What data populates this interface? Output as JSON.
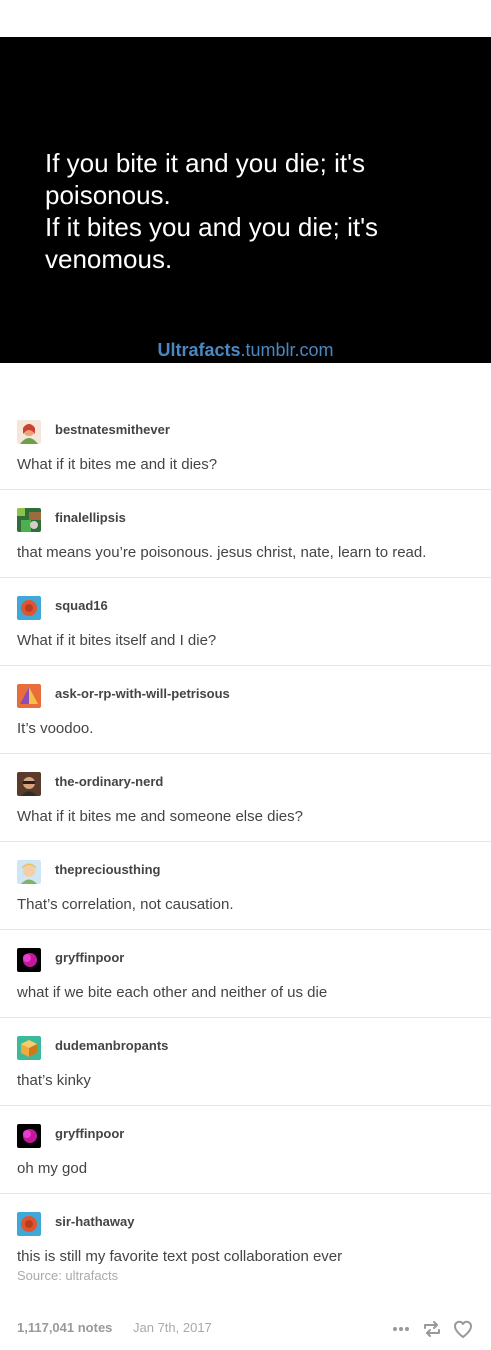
{
  "post": {
    "quote_lines": [
      "If you bite it and you die; it's",
      "poisonous.",
      "If it bites you and you die; it's",
      "venomous."
    ],
    "watermark_brand": "Ultrafacts",
    "watermark_domain": ".tumblr.com"
  },
  "reblogs": [
    {
      "username": "bestnatesmithever",
      "text": "What if it bites me and it dies?"
    },
    {
      "username": "finalellipsis",
      "text": "that means you’re poisonous. jesus christ, nate, learn to read."
    },
    {
      "username": "squad16",
      "text": "What if it bites itself and I die?"
    },
    {
      "username": "ask-or-rp-with-will-petrisous",
      "text": "It’s voodoo."
    },
    {
      "username": "the-ordinary-nerd",
      "text": "What if it bites me and someone else dies?"
    },
    {
      "username": "thepreciousthing",
      "text": "That’s correlation, not causation."
    },
    {
      "username": "gryffinpoor",
      "text": "what if we bite each other and neither of us die"
    },
    {
      "username": "dudemanbropants",
      "text": "that’s kinky"
    },
    {
      "username": "gryffinpoor",
      "text": "oh my god"
    },
    {
      "username": "sir-hathaway",
      "text": "this is still my favorite text post collaboration ever"
    }
  ],
  "source": "Source: ultrafacts",
  "footer": {
    "notes": "1,117,041 notes",
    "date": "Jan 7th, 2017"
  },
  "icons": {
    "more": "more-icon",
    "reblog": "reblog-icon",
    "like": "heart-icon"
  }
}
